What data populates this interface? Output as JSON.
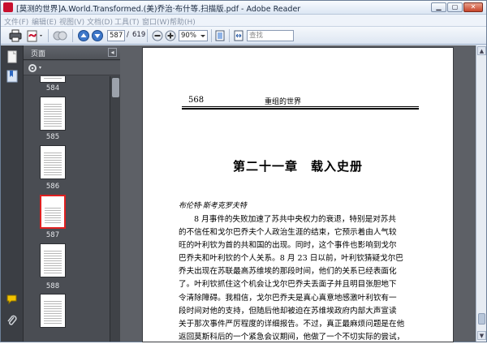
{
  "window": {
    "title": "[莫测的世界]A.World.Transformed.(美)乔治·布什等.扫描版.pdf - Adobe Reader",
    "min_glyph": "▁",
    "max_glyph": "▢",
    "close_glyph": "✕"
  },
  "menu": {
    "items": [
      "文件(F)",
      "编辑(E)",
      "视图(V)",
      "文档(D)",
      "工具(T)",
      "窗口(W)",
      "帮助(H)"
    ]
  },
  "toolbar": {
    "current_page": "587",
    "page_separator": "/",
    "total_pages": "619",
    "zoom": "90%",
    "find_placeholder": "查找"
  },
  "pages_panel": {
    "title": "页面",
    "collapse_glyph": "◂",
    "thumbnails": [
      {
        "label": "584",
        "selected": false
      },
      {
        "label": "585",
        "selected": false
      },
      {
        "label": "586",
        "selected": false
      },
      {
        "label": "587",
        "selected": true
      },
      {
        "label": "588",
        "selected": false
      }
    ]
  },
  "document": {
    "page_number": "568",
    "book_title": "重组的世界",
    "chapter_title": "第二十一章　载入史册",
    "section_author": "布伦特·斯考克罗夫特",
    "lines": [
      "8 月事件的失败加速了苏共中央权力的衰退，特别是对苏共",
      "的不信任和戈尔巴乔夫个人政治生涯的结束，它预示着由人气较",
      "旺的叶利钦为首的共和国的出现。同时，这个事件也影响到戈尔",
      "巴乔夫和叶利钦的个人关系。8 月 23 日以前，叶利钦猜疑戈尔巴",
      "乔夫出现在苏联最高苏维埃的那段时间，他们的关系已经表面化",
      "了。叶利钦抓住这个机会让戈尔巴乔夫丢面子并且明目张胆地下",
      "令清除障碍。我相信，戈尔巴乔夫是真心真意地感激叶利钦有一",
      "段时间对他的支持，但随后他却被迫在苏维埃政府内部大声宣读",
      "关于那次事件严厉程度的详细报告。不过，真正最麻烦问题是在他",
      "返回莫斯科后的一个紧急会议期间，他做了一个不切实际的尝试，"
    ]
  },
  "colors": {
    "panel_dark": "#3b3e44",
    "doc_background": "#5d6066",
    "selection_red": "#e02020"
  }
}
